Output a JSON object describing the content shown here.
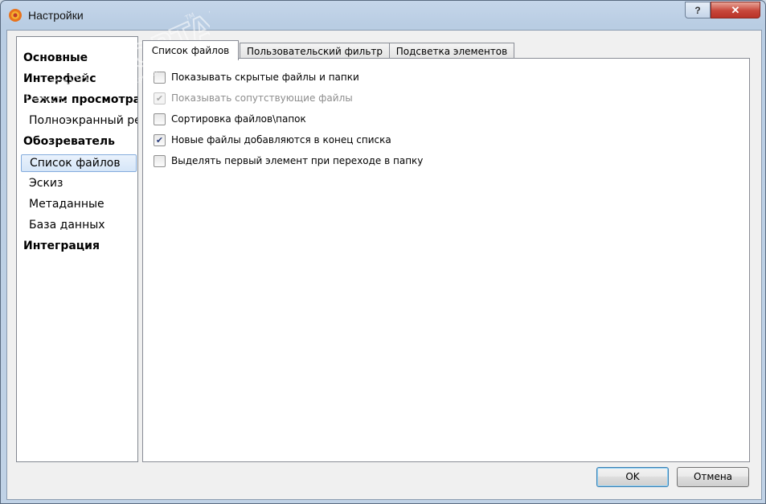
{
  "window": {
    "title": "Настройки",
    "help_label": "?",
    "close_label": "✕"
  },
  "sidebar": {
    "items": [
      {
        "label": "Основные",
        "bold": true
      },
      {
        "label": "Интерфейс",
        "bold": true
      },
      {
        "label": "Режим просмотра",
        "bold": true
      },
      {
        "label": "Полноэкранный ре",
        "bold": false
      },
      {
        "label": "Обозреватель",
        "bold": true
      },
      {
        "label": "Список файлов",
        "bold": false,
        "selected": true
      },
      {
        "label": "Эскиз",
        "bold": false
      },
      {
        "label": "Метаданные",
        "bold": false
      },
      {
        "label": "База данных",
        "bold": false
      },
      {
        "label": "Интеграция",
        "bold": true
      }
    ]
  },
  "tabs": [
    {
      "label": "Список файлов",
      "active": true
    },
    {
      "label": "Пользовательский фильтр",
      "active": false
    },
    {
      "label": "Подсветка элементов",
      "active": false
    }
  ],
  "options": [
    {
      "label": "Показывать скрытые файлы и папки",
      "checked": false,
      "disabled": false
    },
    {
      "label": "Показывать сопутствующие файлы",
      "checked": true,
      "disabled": true
    },
    {
      "label": "Сортировка файлов\\папок",
      "checked": false,
      "disabled": false
    },
    {
      "label": "Новые файлы добавляются в конец списка",
      "checked": true,
      "disabled": false
    },
    {
      "label": "Выделять первый элемент при переходе в папку",
      "checked": false,
      "disabled": false
    }
  ],
  "buttons": {
    "ok_label": "OK",
    "cancel_label": "Отмена"
  },
  "watermark": {
    "text": "SOFTPORTAL",
    "url": "www.softportal.com",
    "tm": "TM"
  },
  "colors": {
    "selection_border": "#84acdd",
    "close_button": "#c7463a",
    "check_mark": "#2b3d7c"
  }
}
